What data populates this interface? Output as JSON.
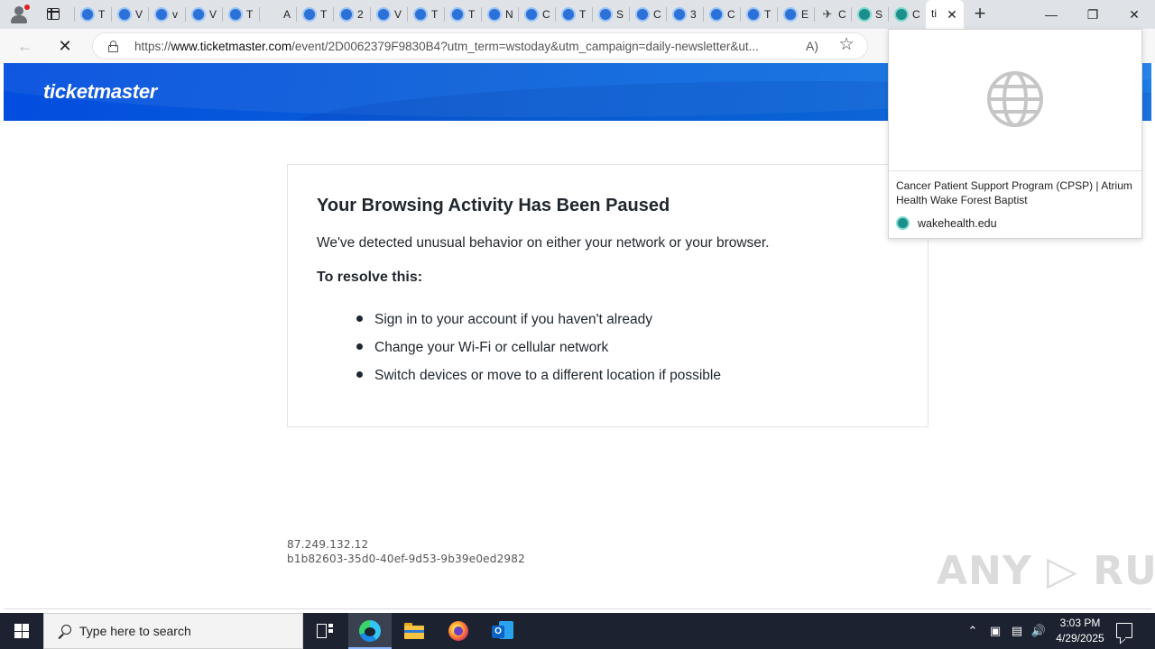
{
  "browser": {
    "tabs": [
      {
        "icon": "globe-icon",
        "title": "T"
      },
      {
        "icon": "globe-icon",
        "title": "V"
      },
      {
        "icon": "globe-icon",
        "title": "v"
      },
      {
        "icon": "globe-icon",
        "title": "V"
      },
      {
        "icon": "globe-icon",
        "title": "T"
      },
      {
        "icon": "blank-icon",
        "title": "A"
      },
      {
        "icon": "globe-icon",
        "title": "T"
      },
      {
        "icon": "globe-icon",
        "title": "2"
      },
      {
        "icon": "globe-icon",
        "title": "V"
      },
      {
        "icon": "globe-icon",
        "title": "T"
      },
      {
        "icon": "globe-icon",
        "title": "T"
      },
      {
        "icon": "globe-icon",
        "title": "N"
      },
      {
        "icon": "globe-icon",
        "title": "C"
      },
      {
        "icon": "globe-icon",
        "title": "T"
      },
      {
        "icon": "globe-icon",
        "title": "S"
      },
      {
        "icon": "globe-icon",
        "title": "C"
      },
      {
        "icon": "globe-icon",
        "title": "3"
      },
      {
        "icon": "globe-icon",
        "title": "C"
      },
      {
        "icon": "globe-icon",
        "title": "T"
      },
      {
        "icon": "globe-icon",
        "title": "E"
      },
      {
        "icon": "bird-icon",
        "title": "C"
      },
      {
        "icon": "teal-globe-icon",
        "title": "S"
      },
      {
        "icon": "teal-globe-icon",
        "title": "C"
      }
    ],
    "active_tab_title": "ti",
    "close_glyph": "✕",
    "new_tab_glyph": "+",
    "window_controls": {
      "minimize": "—",
      "maximize": "❐",
      "close": "✕"
    },
    "url": {
      "prefix": "https://",
      "host": "www.ticketmaster.com",
      "path": "/event/2D0062379F9830B4?utm_term=wstoday&utm_campaign=daily-newsletter&ut..."
    },
    "read_aloud_glyph": "A&#x29;",
    "favorite_glyph": "☆"
  },
  "page": {
    "logo": "ticketmaster",
    "heading": "Your Browsing Activity Has Been Paused",
    "message": "We've detected unusual behavior on either your network or your browser.",
    "resolve_heading": "To resolve this:",
    "steps": [
      "Sign in to your account if you haven't already",
      "Change your Wi-Fi or cellular network",
      "Switch devices or move to a different location if possible"
    ],
    "ip": "87.249.132.12",
    "ref_id": "b1b82603-35d0-40ef-9d53-9b39e0ed2982",
    "watermark": "ANY ▷ RUN"
  },
  "hover_card": {
    "title": "Cancer Patient Support Program (CPSP) | Atrium Health Wake Forest Baptist",
    "domain": "wakehealth.edu"
  },
  "taskbar": {
    "search_placeholder": "Type here to search",
    "time": "3:03 PM",
    "date": "4/29/2025",
    "tray_icons": [
      "chevron-up-icon",
      "meet-now-icon",
      "network-icon",
      "volume-icon"
    ]
  }
}
